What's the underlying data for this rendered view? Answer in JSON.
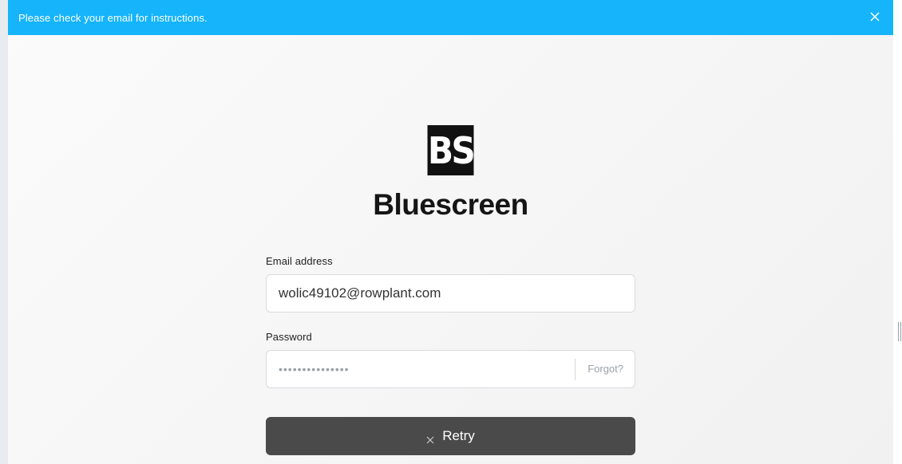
{
  "notification": {
    "message": "Please check your email for instructions.",
    "close_icon": "close-icon"
  },
  "brand": {
    "logo_text": "BS",
    "name": "Bluescreen"
  },
  "form": {
    "email_label": "Email address",
    "email_value": "wolic49102@rowplant.com",
    "password_label": "Password",
    "password_masked": "•••••••••••••••",
    "forgot_label": "Forgot?",
    "submit_label": "Retry",
    "submit_icon": "close-icon"
  },
  "colors": {
    "banner": "#16b4fb",
    "button": "#4a4a4a",
    "logo_bg": "#111111"
  }
}
